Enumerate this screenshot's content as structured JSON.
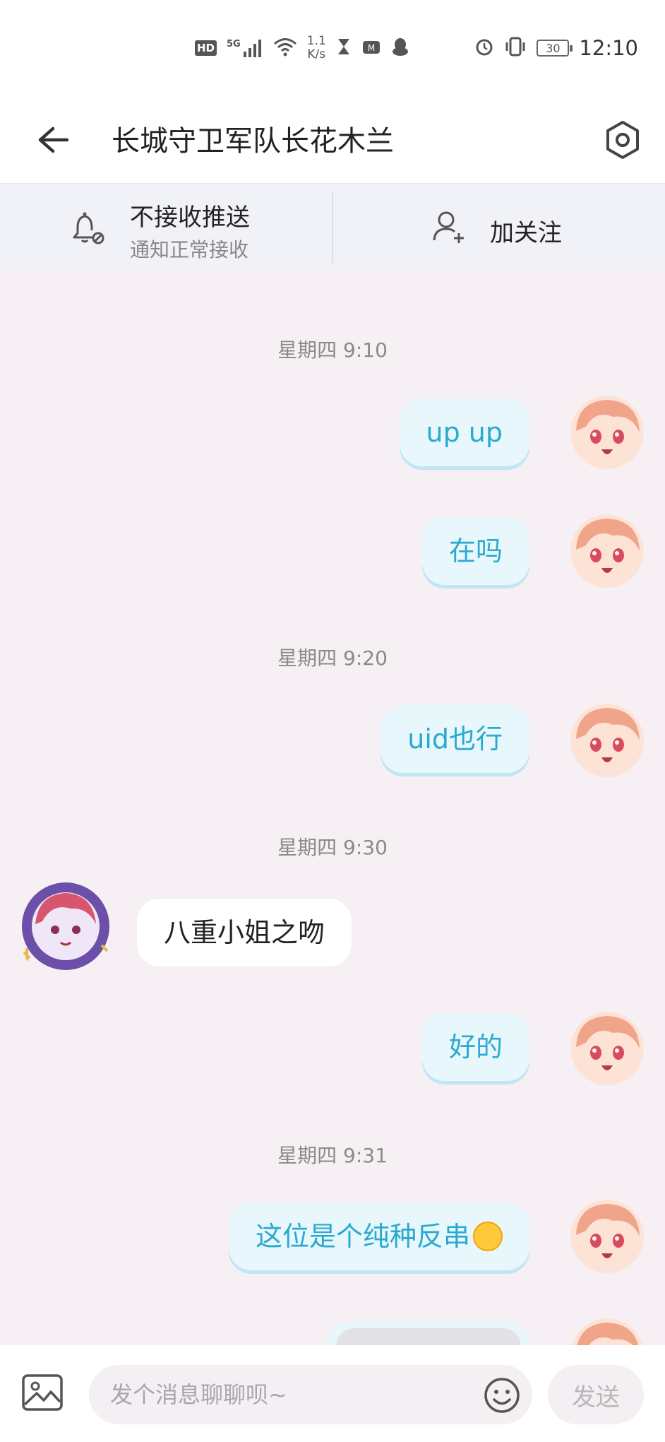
{
  "status_bar": {
    "hd": "HD",
    "signal": "5G",
    "net_speed_value": "1.1",
    "net_speed_unit": "K/s",
    "battery": "30",
    "time": "12:10"
  },
  "header": {
    "title": "长城守卫军队长花木兰"
  },
  "actionbar": {
    "push_title": "不接收推送",
    "push_sub": "通知正常接收",
    "follow_label": "加关注"
  },
  "messages": {
    "t1": "星期四 9:10",
    "m1": "up up",
    "m2": "在吗",
    "t2": "星期四 9:20",
    "m3": "uid也行",
    "t3": "星期四 9:30",
    "m4": "八重小姐之吻",
    "m5": "好的",
    "t4": "星期四 9:31",
    "m6": "这位是个纯种反串"
  },
  "input": {
    "placeholder": "发个消息聊聊呗~",
    "send_label": "发送"
  },
  "colors": {
    "accent": "#2aa9d2",
    "out_bubble": "#e7f7fb",
    "background": "#f6eff4"
  }
}
